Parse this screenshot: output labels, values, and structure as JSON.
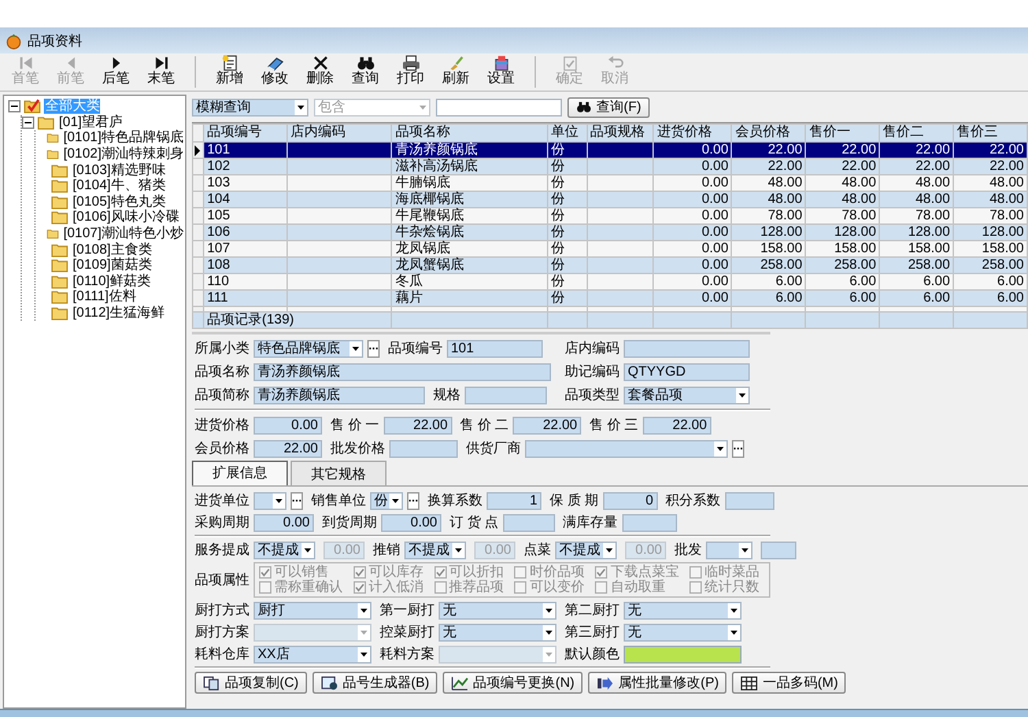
{
  "window": {
    "title": "品项资料"
  },
  "toolbar": {
    "groups": [
      {
        "items": [
          {
            "label": "首笔",
            "disabled": true
          },
          {
            "label": "前笔",
            "disabled": true
          },
          {
            "label": "后笔",
            "disabled": false
          },
          {
            "label": "末笔",
            "disabled": false
          }
        ]
      },
      {
        "items": [
          {
            "label": "新增",
            "disabled": false
          },
          {
            "label": "修改",
            "disabled": false
          },
          {
            "label": "删除",
            "disabled": false
          },
          {
            "label": "查询",
            "disabled": false
          },
          {
            "label": "打印",
            "disabled": false
          },
          {
            "label": "刷新",
            "disabled": false
          },
          {
            "label": "设置",
            "disabled": false
          }
        ]
      },
      {
        "items": [
          {
            "label": "确定",
            "disabled": true
          },
          {
            "label": "取消",
            "disabled": true
          }
        ]
      }
    ]
  },
  "tree": [
    {
      "label": "全部大类",
      "checked": true,
      "selected": true,
      "expanded": true,
      "children": [
        {
          "label": "[01]望君庐",
          "selected": false,
          "expanded": true,
          "children": [
            {
              "label": "[0101]特色品牌锅底",
              "selected": false
            },
            {
              "label": "[0102]潮汕特辣刺身",
              "selected": false
            },
            {
              "label": "[0103]精选野味",
              "selected": false
            },
            {
              "label": "[0104]牛、猪类",
              "selected": false
            },
            {
              "label": "[0105]特色丸类",
              "selected": false
            },
            {
              "label": "[0106]风味小冷碟",
              "selected": false
            },
            {
              "label": "[0107]潮汕特色小炒",
              "selected": false
            },
            {
              "label": "[0108]主食类",
              "selected": false
            },
            {
              "label": "[0109]菌菇类",
              "selected": false
            },
            {
              "label": "[0110]鲜菇类",
              "selected": false
            },
            {
              "label": "[0111]佐料",
              "selected": false
            },
            {
              "label": "[0112]生猛海鲜",
              "selected": false
            }
          ]
        }
      ]
    }
  ],
  "search": {
    "mode": {
      "value": "模糊查询",
      "disabled": false
    },
    "operator": {
      "value": "包含",
      "disabled": true
    },
    "button": "查询(F)"
  },
  "table": {
    "columns": [
      "品项编号",
      "店内编码",
      "品项名称",
      "单位",
      "品项规格",
      "进货价格",
      "会员价格",
      "售价一",
      "售价二",
      "售价三"
    ],
    "rows": [
      {
        "selected": true,
        "cells": [
          "101",
          "",
          "青汤养颜锅底",
          "份",
          "",
          "0.00",
          "22.00",
          "22.00",
          "22.00",
          "22.00"
        ]
      },
      {
        "selected": false,
        "cells": [
          "102",
          "",
          "滋补高汤锅底",
          "份",
          "",
          "0.00",
          "22.00",
          "22.00",
          "22.00",
          "22.00"
        ]
      },
      {
        "selected": false,
        "cells": [
          "103",
          "",
          "牛腩锅底",
          "份",
          "",
          "0.00",
          "48.00",
          "48.00",
          "48.00",
          "48.00"
        ]
      },
      {
        "selected": false,
        "cells": [
          "104",
          "",
          "海底椰锅底",
          "份",
          "",
          "0.00",
          "48.00",
          "48.00",
          "48.00",
          "48.00"
        ]
      },
      {
        "selected": false,
        "cells": [
          "105",
          "",
          "牛尾鞭锅底",
          "份",
          "",
          "0.00",
          "78.00",
          "78.00",
          "78.00",
          "78.00"
        ]
      },
      {
        "selected": false,
        "cells": [
          "106",
          "",
          "牛杂烩锅底",
          "份",
          "",
          "0.00",
          "128.00",
          "128.00",
          "128.00",
          "128.00"
        ]
      },
      {
        "selected": false,
        "cells": [
          "107",
          "",
          "龙凤锅底",
          "份",
          "",
          "0.00",
          "158.00",
          "158.00",
          "158.00",
          "158.00"
        ]
      },
      {
        "selected": false,
        "cells": [
          "108",
          "",
          "龙凤蟹锅底",
          "份",
          "",
          "0.00",
          "258.00",
          "258.00",
          "258.00",
          "258.00"
        ]
      },
      {
        "selected": false,
        "cells": [
          "110",
          "",
          "冬瓜",
          "份",
          "",
          "0.00",
          "6.00",
          "6.00",
          "6.00",
          "6.00"
        ]
      },
      {
        "selected": false,
        "cells": [
          "111",
          "",
          "藕片",
          "份",
          "",
          "0.00",
          "6.00",
          "6.00",
          "6.00",
          "6.00"
        ]
      }
    ],
    "footer": "品项记录(139)"
  },
  "form": {
    "groups": [
      {
        "rows": [
          [
            {
              "label": "所属小类",
              "kind": "select_more",
              "value": "特色品牌锅底"
            },
            {
              "label": "品项编号",
              "kind": "text",
              "value": "101"
            }
          ],
          [
            {
              "label": "品项名称",
              "kind": "text",
              "value": "青汤养颜锅底"
            }
          ],
          [
            {
              "label": "品项简称",
              "kind": "text",
              "value": "青汤养颜锅底"
            },
            {
              "label": "规格",
              "kind": "text"
            }
          ]
        ],
        "side": [
          {
            "label": "店内编码",
            "kind": "text"
          },
          {
            "label": "助记编码",
            "kind": "text",
            "value": "QTYYGD"
          },
          {
            "label": "品项类型",
            "kind": "select",
            "value": "套餐品项"
          }
        ]
      },
      {
        "rows": [
          [
            {
              "label": "进货价格",
              "kind": "number",
              "value": "0.00"
            },
            {
              "label": "售 价 一",
              "kind": "number",
              "value": "22.00"
            },
            {
              "label": "售 价 二",
              "kind": "number",
              "value": "22.00"
            },
            {
              "label": "售 价 三",
              "kind": "number",
              "value": "22.00"
            }
          ],
          [
            {
              "label": "会员价格",
              "kind": "number",
              "value": "22.00"
            },
            {
              "label": "批发价格",
              "kind": "number"
            },
            {
              "label": "供货厂商",
              "kind": "select_more"
            }
          ]
        ]
      }
    ]
  },
  "tabs": [
    {
      "label": "扩展信息",
      "selected": true
    },
    {
      "label": "其它规格",
      "selected": false
    }
  ],
  "tab_panel": {
    "units": {
      "rows": [
        [
          {
            "label": "进货单位",
            "kind": "select_more"
          },
          {
            "label": "销售单位",
            "kind": "select_more",
            "value": "份"
          },
          {
            "label": "换算系数",
            "kind": "number",
            "value": "1"
          },
          {
            "label": "保 质 期",
            "kind": "number",
            "value": "0"
          },
          {
            "label": "积分系数",
            "kind": "number"
          }
        ],
        [
          {
            "label": "采购周期",
            "kind": "number",
            "value": "0.00"
          },
          {
            "label": "到货周期",
            "kind": "number",
            "value": "0.00"
          },
          {
            "label": "订 货 点",
            "kind": "number"
          },
          {
            "label": "满库存量",
            "kind": "number"
          }
        ]
      ]
    },
    "commission": {
      "rows": [
        [
          {
            "label": "服务提成",
            "kind": "select",
            "value": "不提成",
            "disabled": false
          },
          {
            "kind": "number",
            "value": "0.00",
            "disabled": true
          },
          {
            "label": "推销",
            "kind": "select",
            "value": "不提成",
            "disabled": false
          },
          {
            "kind": "number",
            "value": "0.00",
            "disabled": true
          },
          {
            "label": "点菜",
            "kind": "select",
            "value": "不提成",
            "disabled": false
          },
          {
            "kind": "number",
            "value": "0.00",
            "disabled": true
          },
          {
            "label": "批发",
            "kind": "select",
            "disabled": false
          },
          {
            "kind": "number",
            "disabled": false
          }
        ]
      ]
    },
    "attributes": {
      "label": "品项属性",
      "options": [
        {
          "label": "可以销售",
          "checked": true
        },
        {
          "label": "可以库存",
          "checked": true
        },
        {
          "label": "可以折扣",
          "checked": true
        },
        {
          "label": "时价品项",
          "checked": false
        },
        {
          "label": "下载点菜宝",
          "checked": true
        },
        {
          "label": "临时菜品",
          "checked": false
        },
        {
          "label": "需称重确认",
          "checked": false
        },
        {
          "label": "计入低消",
          "checked": true
        },
        {
          "label": "推荐品项",
          "checked": false
        },
        {
          "label": "可以变价",
          "checked": false
        },
        {
          "label": "自动取重",
          "checked": false
        },
        {
          "label": "统计只数",
          "checked": false
        }
      ]
    },
    "kitchen": {
      "rows": [
        [
          {
            "label": "厨打方式",
            "kind": "select",
            "value": "厨打"
          },
          {
            "label": "第一厨打",
            "kind": "select",
            "value": "无"
          },
          {
            "label": "第二厨打",
            "kind": "select",
            "value": "无"
          }
        ],
        [
          {
            "label": "厨打方案",
            "kind": "select",
            "disabled": true
          },
          {
            "label": "控菜厨打",
            "kind": "select",
            "value": "无",
            "disabled": false
          },
          {
            "label": "第三厨打",
            "kind": "select",
            "value": "无",
            "disabled": false
          }
        ],
        [
          {
            "label": "耗料仓库",
            "kind": "select",
            "value": "XX店",
            "disabled": false
          },
          {
            "label": "耗料方案",
            "kind": "select",
            "disabled": true
          },
          {
            "label": "默认颜色",
            "kind": "color",
            "color": "#b8e34c",
            "disabled": false
          }
        ]
      ]
    }
  },
  "actions": [
    "品项复制(C)",
    "品号生成器(B)",
    "品项编号更换(N)",
    "属性批量修改(P)",
    "一品多码(M)"
  ]
}
